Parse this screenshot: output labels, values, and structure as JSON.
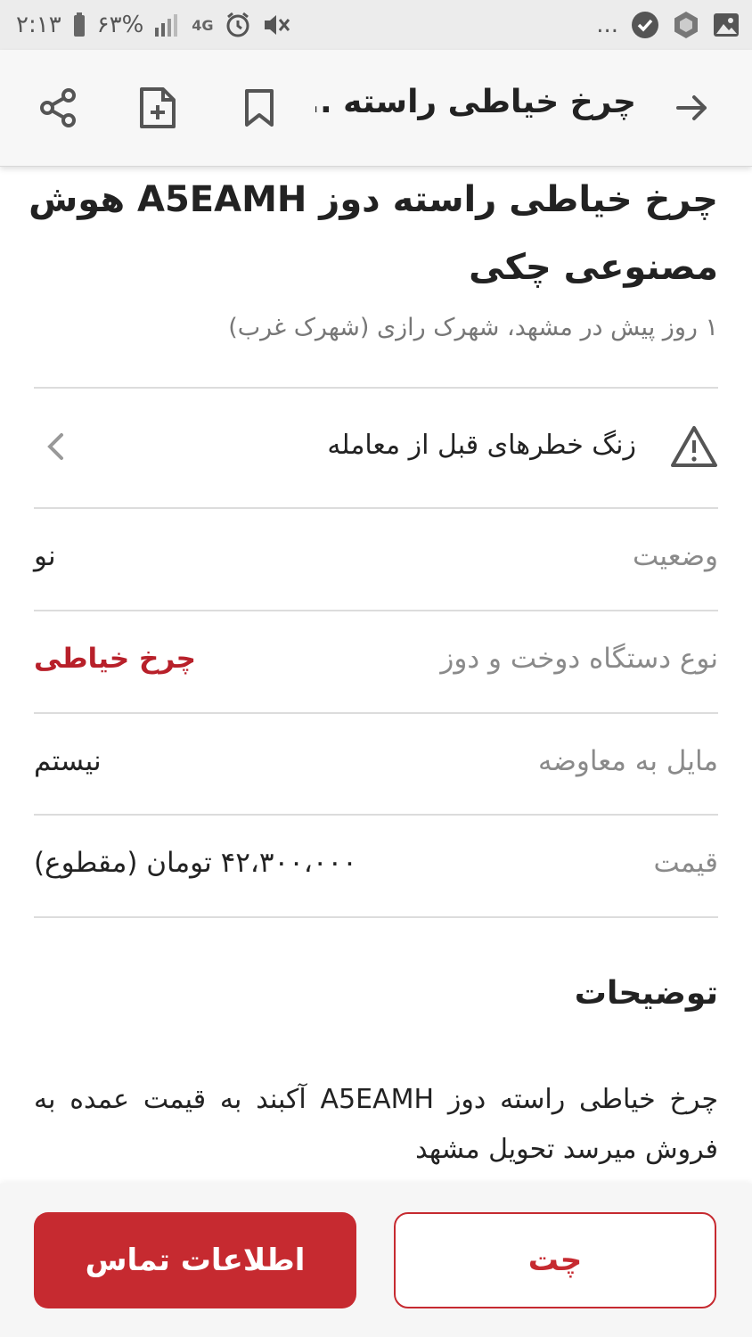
{
  "status_bar": {
    "time": "۲:۱۳",
    "battery": "۶۳%",
    "network": "4G",
    "more": "..."
  },
  "app_bar": {
    "title": "چرخ خیاطی راسته ...",
    "icons": [
      "share-icon",
      "add-document-icon",
      "bookmark-icon",
      "back-arrow-icon"
    ]
  },
  "listing": {
    "title": "چرخ خیاطی راسته دوز  A5EAMH هوش مصنوعی چکی",
    "subtitle": "۱ روز پیش در مشهد، شهرک رازی (شهرک غرب)",
    "warning": "زنگ خطرهای قبل از معامله",
    "attributes": [
      {
        "label": "وضعیت",
        "value": "نو"
      },
      {
        "label": "نوع دستگاه دوخت و دوز",
        "value": "چرخ خیاطی"
      },
      {
        "label": "مایل به معاوضه",
        "value": "نیستم"
      },
      {
        "label": "قیمت",
        "value": "۴۲،۳۰۰،۰۰۰ تومان (مقطوع)"
      }
    ],
    "description_title": "توضیحات",
    "description": "چرخ خیاطی  راسته دوز  A5EAMH  آکبند به قیمت عمده به فروش میرسد  تحویل مشهد"
  },
  "actions": {
    "contact_label": "اطلاعات تماس",
    "chat_label": "چت"
  },
  "colors": {
    "accent": "#c62a30",
    "muted_text": "#8a8a8a"
  }
}
